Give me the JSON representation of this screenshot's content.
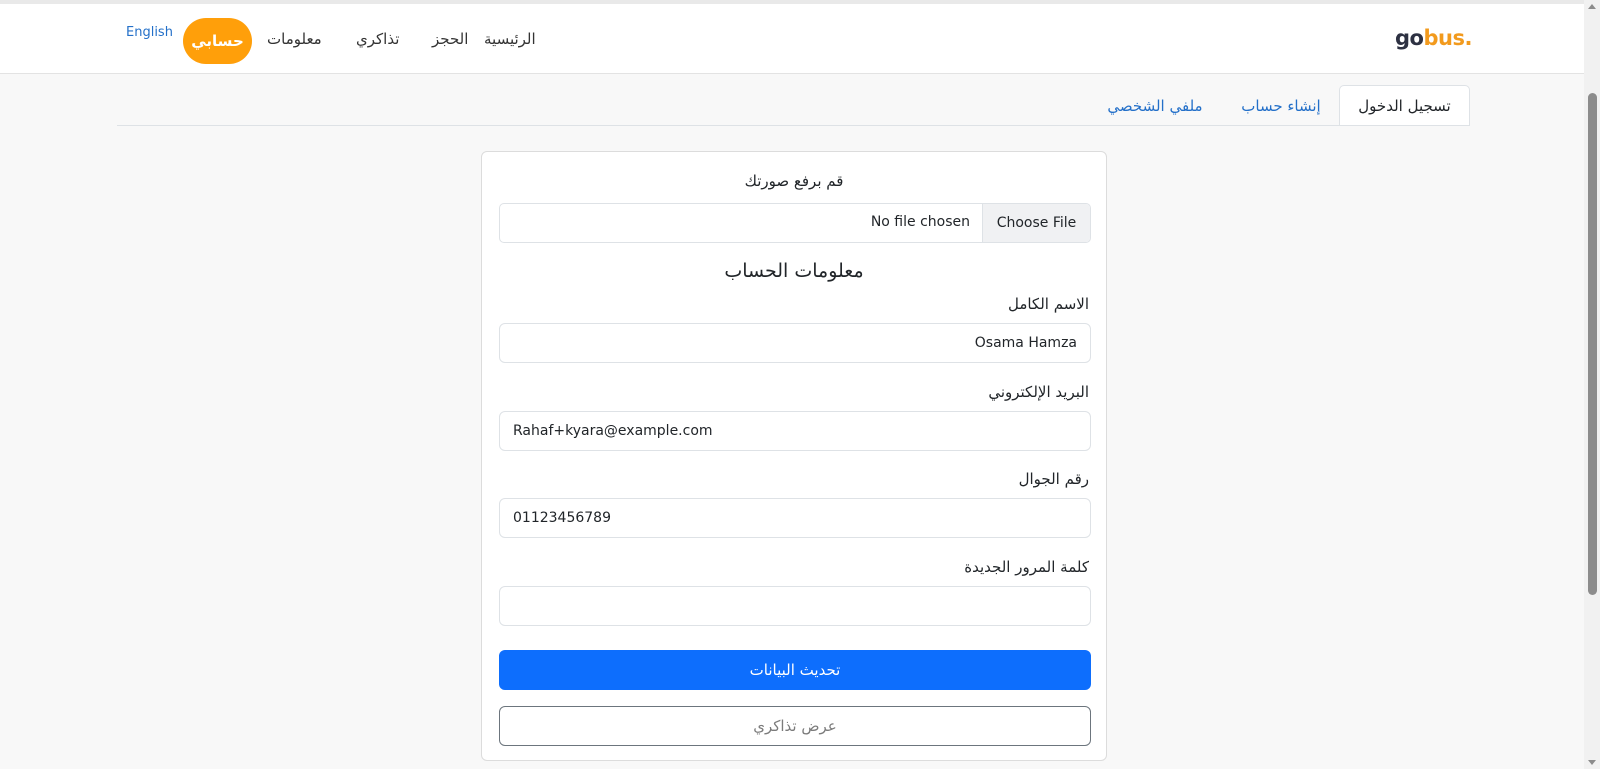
{
  "brand": {
    "logo_main": "go",
    "logo_accent": "bus."
  },
  "nav": {
    "home": "الرئيسية",
    "booking": "الحجز",
    "tickets": "تذاكري",
    "info": "معلومات",
    "account": "حسابي",
    "language": "English"
  },
  "tabs": {
    "login": "تسجيل الدخول",
    "register": "إنشاء حساب",
    "profile": "ملفي الشخصي"
  },
  "form": {
    "upload_title": "قم برفع صورتك",
    "file_button": "Choose File",
    "file_status": "No file chosen",
    "section_title": "معلومات الحساب",
    "fullname_label": "الاسم الكامل",
    "fullname_value": "Osama Hamza",
    "email_label": "البريد الإلكتروني",
    "email_value": "Rahaf+kyara@example.com",
    "phone_label": "رقم الجوال",
    "phone_value": "01123456789",
    "password_label": "كلمة المرور الجديدة",
    "password_value": "",
    "update_button": "تحديث البيانات",
    "tickets_button": "عرض تذاكري"
  },
  "colors": {
    "accent_orange": "#ff9f0a",
    "primary_blue": "#0d6efd",
    "link_blue": "#2470c9"
  }
}
